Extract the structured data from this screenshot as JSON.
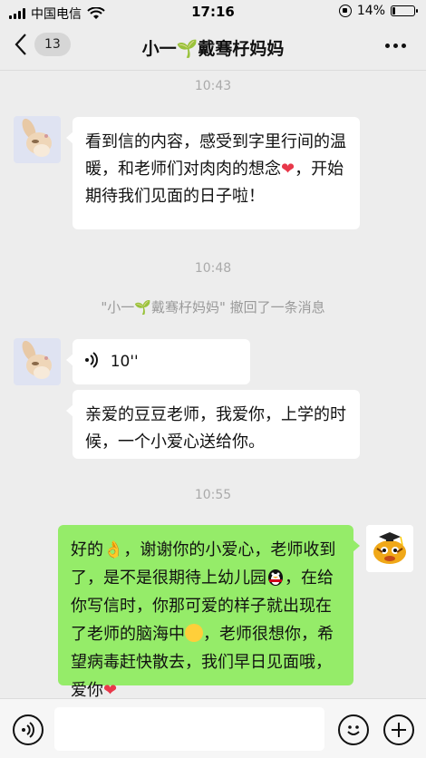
{
  "status": {
    "carrier": "中国电信",
    "time": "17:16",
    "battery": "14%",
    "battery_level": 0.14
  },
  "header": {
    "back_count": "13",
    "title_prefix": "小一",
    "title_sprout": "🌱",
    "title_suffix": "戴骞杍妈妈"
  },
  "messages": {
    "ts1": "10:43",
    "msg1": "看到信的内容，感受到字里行间的温暖，和老师们对肉肉的想念",
    "msg1_heart": "❤",
    "msg1_tail": "，开始期待我们见面的日子啦！",
    "ts2": "10:48",
    "recall_name_prefix": "\"小一",
    "recall_sprout": "🌱",
    "recall_name_suffix": "戴骞杍妈妈\"",
    "recall_text": " 撤回了一条消息",
    "voice_duration": "10''",
    "msg2": "亲爱的豆豆老师，我爱你，上学的时候，一个小爱心送给你。",
    "ts3": "10:55",
    "reply_1": "好的",
    "reply_ok": "👌",
    "reply_2": "，谢谢你的小爱心，老师收到了，是不是很期待上幼儿园",
    "reply_3": "，在给你写信时，你那可爱的样子就出现在了老师的脑海中",
    "reply_4": "，老师很想你，希望病毒赶快散去，我们早日见面哦，爱你",
    "reply_heart": "❤"
  },
  "icons": {
    "voice_toggle": "voice-icon",
    "emoji": "emoji-icon",
    "add": "plus-icon"
  },
  "colors": {
    "outgoing_bubble": "#95ec69",
    "incoming_bubble": "#ffffff",
    "background": "#ededed"
  }
}
